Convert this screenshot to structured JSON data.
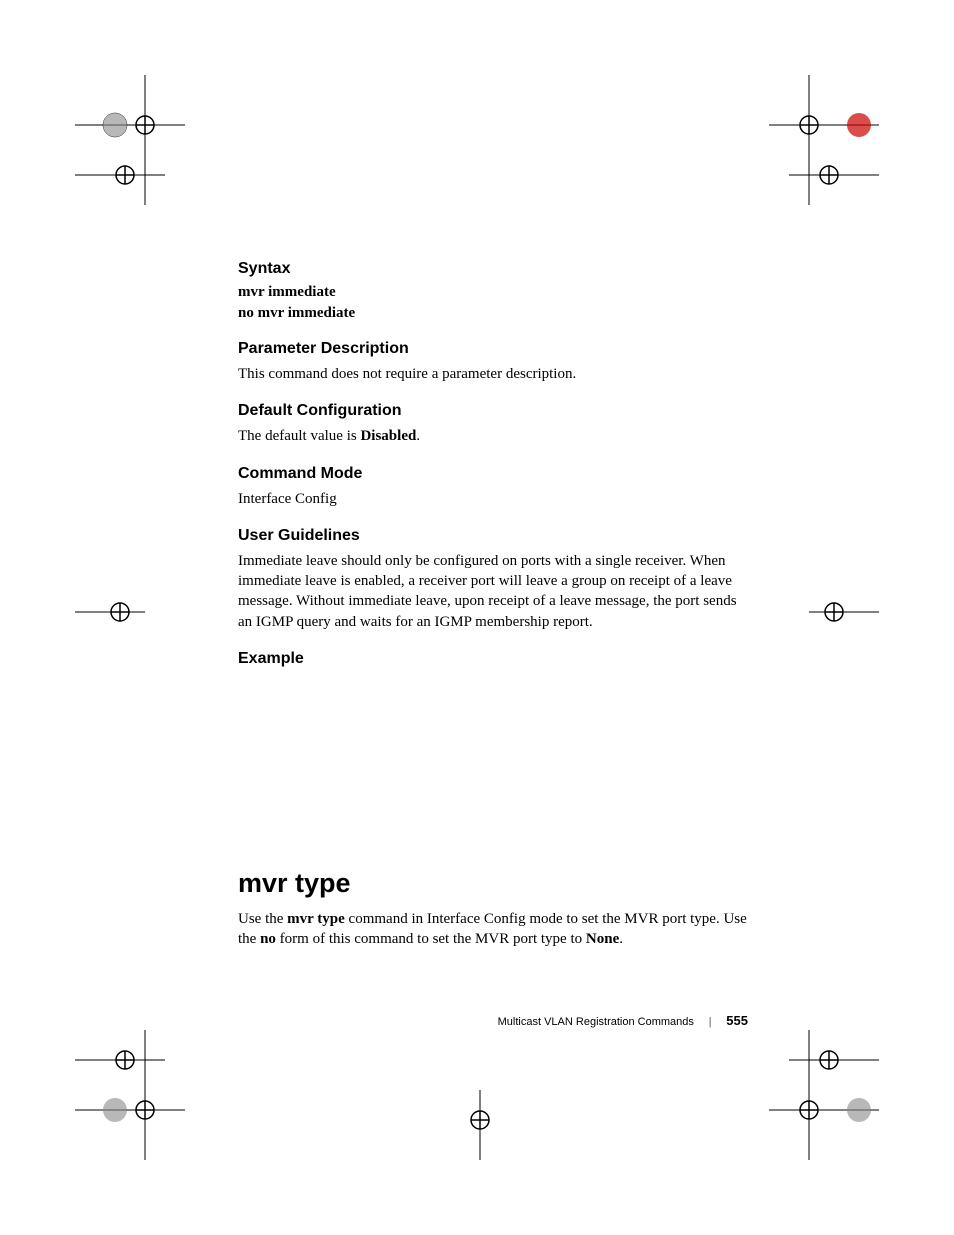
{
  "sections": {
    "syntax": {
      "heading": "Syntax",
      "line1": "mvr immediate",
      "line2": "no mvr immediate"
    },
    "parameter": {
      "heading": "Parameter Description",
      "text": "This command does not require a parameter description."
    },
    "default_config": {
      "heading": "Default Configuration",
      "text_pre": "The default value is ",
      "text_bold": "Disabled",
      "text_post": "."
    },
    "command_mode": {
      "heading": "Command Mode",
      "text": "Interface Config"
    },
    "user_guidelines": {
      "heading": "User Guidelines",
      "text": "Immediate leave should only be configured on ports with a single receiver. When immediate leave is enabled, a receiver port will leave a group on receipt of a leave message. Without immediate leave, upon receipt of a leave message, the port sends an IGMP query and waits for an IGMP membership report."
    },
    "example": {
      "heading": "Example"
    }
  },
  "command": {
    "title": "mvr type",
    "desc_pre": "Use the ",
    "desc_bold1": "mvr type",
    "desc_mid1": " command in Interface Config mode to set the MVR port type. Use the ",
    "desc_bold2": "no",
    "desc_mid2": " form of this command to set the MVR port type to ",
    "desc_bold3": "None",
    "desc_post": "."
  },
  "footer": {
    "text": "Multicast VLAN Registration Commands",
    "page": "555"
  }
}
